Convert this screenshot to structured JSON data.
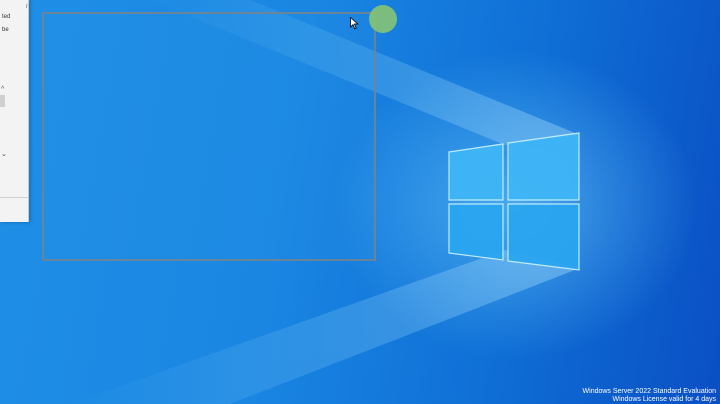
{
  "desktop": {
    "wallpaper": "windows-logo-light-beams",
    "colors": {
      "background": "#1a86e2",
      "glow": "#7fd7ff"
    }
  },
  "partial_window": {
    "top_fragment": "n",
    "fragments": [
      "ted",
      "be"
    ],
    "scroll_up_icon": "^",
    "dropdown_chevron": "⌄"
  },
  "selection": {
    "label": "snip-selection-rectangle"
  },
  "watermark": {
    "line1": "Windows Server 2022 Standard Evaluation",
    "line2": "Windows License valid for 4 days"
  }
}
